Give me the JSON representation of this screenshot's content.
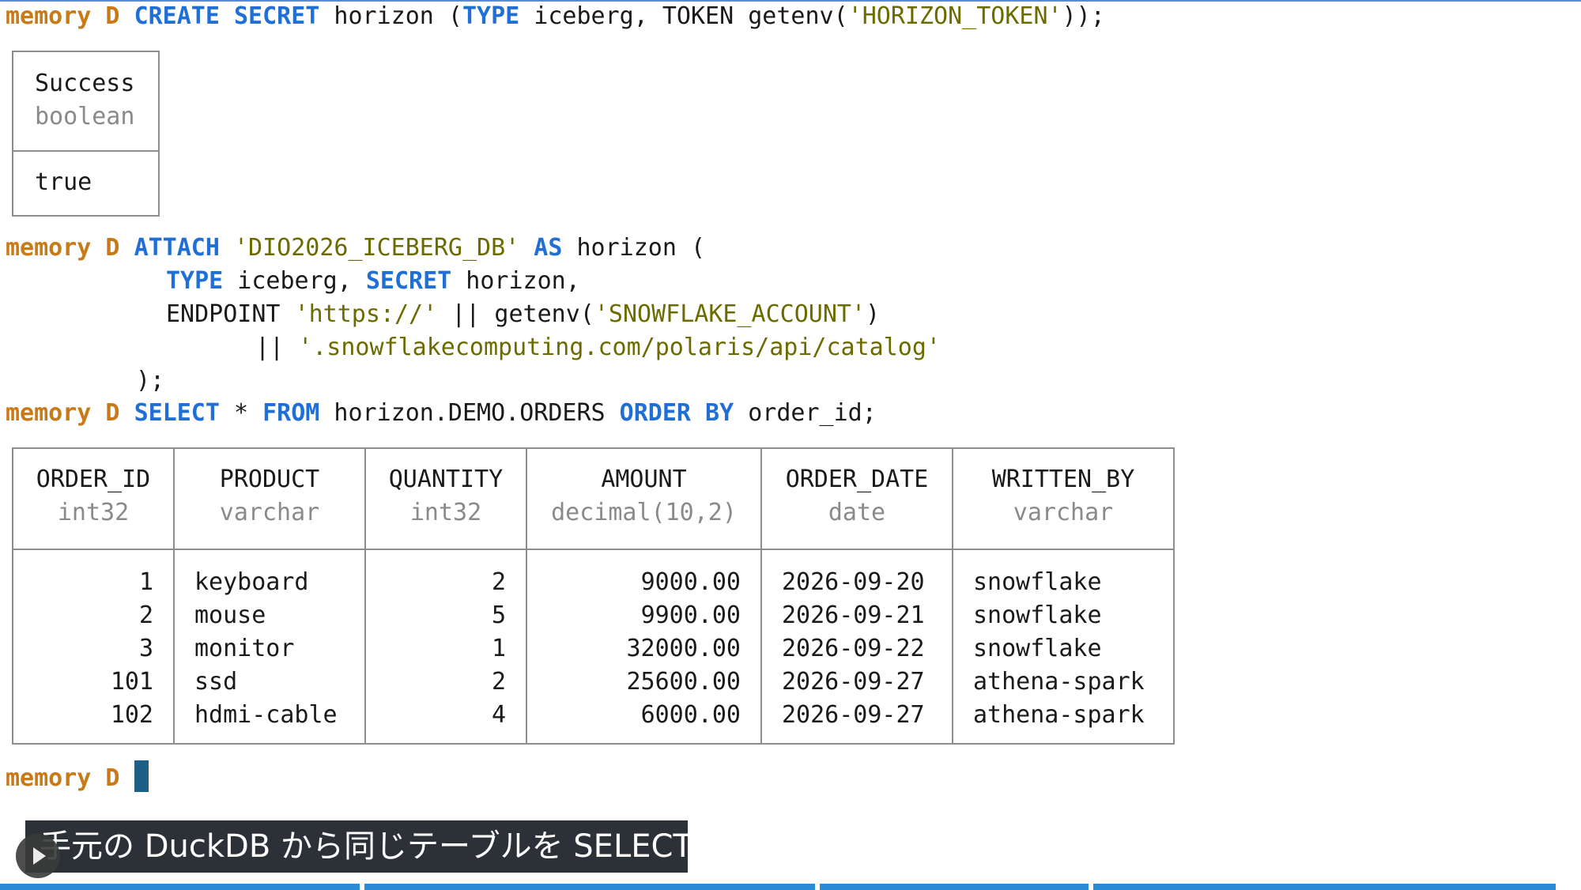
{
  "terminal": {
    "prompt": "memory D",
    "line1": {
      "kw1": "CREATE SECRET",
      "t1": " horizon (",
      "kw2": "TYPE",
      "t2": " iceberg, TOKEN getenv(",
      "s1": "'HORIZON_TOKEN'",
      "t3": "));"
    },
    "result1": {
      "column": "Success",
      "type": "boolean",
      "value": "true"
    },
    "attach": {
      "kw1": "ATTACH",
      "s1": "'DIO2026_ICEBERG_DB'",
      "kw2": "AS",
      "t1": " horizon (",
      "kw3": "TYPE",
      "t2": " iceberg, ",
      "kw4": "SECRET",
      "t3": " horizon,",
      "t4": "ENDPOINT ",
      "s2": "'https://'",
      "t5": " || getenv(",
      "s3": "'SNOWFLAKE_ACCOUNT'",
      "t6": ")",
      "t7": "|| ",
      "s4": "'.snowflakecomputing.com/polaris/api/catalog'",
      "t8": ");"
    },
    "select": {
      "kw1": "SELECT",
      "t1": " * ",
      "kw2": "FROM",
      "t2": " horizon.DEMO.ORDERS ",
      "kw3": "ORDER BY",
      "t3": " order_id;"
    },
    "table": {
      "columns": [
        {
          "name": "ORDER_ID",
          "type": "int32"
        },
        {
          "name": "PRODUCT",
          "type": "varchar"
        },
        {
          "name": "QUANTITY",
          "type": "int32"
        },
        {
          "name": "AMOUNT",
          "type": "decimal(10,2)"
        },
        {
          "name": "ORDER_DATE",
          "type": "date"
        },
        {
          "name": "WRITTEN_BY",
          "type": "varchar"
        }
      ],
      "rows": [
        [
          "1",
          "keyboard",
          "2",
          "9000.00",
          "2026-09-20",
          "snowflake"
        ],
        [
          "2",
          "mouse",
          "5",
          "9900.00",
          "2026-09-21",
          "snowflake"
        ],
        [
          "3",
          "monitor",
          "1",
          "32000.00",
          "2026-09-22",
          "snowflake"
        ],
        [
          "101",
          "ssd",
          "2",
          "25600.00",
          "2026-09-27",
          "athena-spark"
        ],
        [
          "102",
          "hdmi-cable",
          "4",
          "6000.00",
          "2026-09-27",
          "athena-spark"
        ]
      ]
    }
  },
  "video": {
    "caption": "手元の DuckDB から同じテーブルを SELECT",
    "play_icon": "play-icon"
  },
  "colors": {
    "prompt": "#c97a16",
    "keyword": "#1f6fd6",
    "string": "#6b6b00",
    "cursor": "#1e5f86",
    "progress": "#2a8bd6"
  }
}
